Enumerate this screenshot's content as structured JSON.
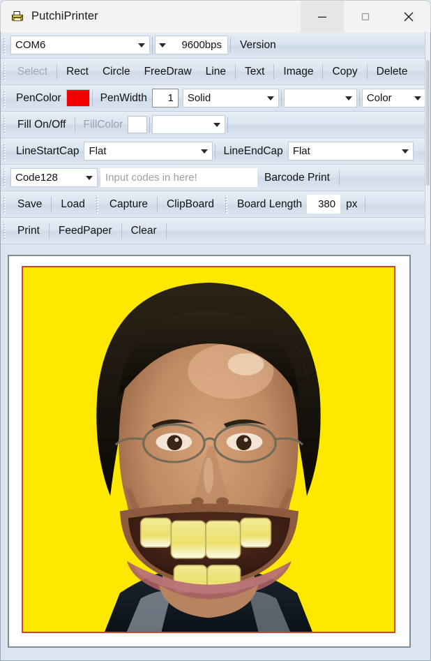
{
  "window": {
    "title": "PutchiPrinter",
    "icon": "printer-icon",
    "controls": {
      "minimize": "—",
      "maximize": "☐",
      "close": "✕"
    }
  },
  "toolbar_rows": {
    "connection": {
      "port_value": "COM6",
      "baud_value": "9600bps",
      "version_label": "Version"
    },
    "tools": {
      "select": "Select",
      "rect": "Rect",
      "circle": "Circle",
      "freedraw": "FreeDraw",
      "line": "Line",
      "text": "Text",
      "image": "Image",
      "copy": "Copy",
      "delete": "Delete"
    },
    "pen": {
      "pencolor_label": "PenColor",
      "pencolor_value": "#f40000",
      "penwidth_label": "PenWidth",
      "penwidth_value": "1",
      "dashstyle_value": "Solid",
      "unnamed_combo_value": "",
      "colormode_value": "Color"
    },
    "fill": {
      "fill_toggle_label": "Fill On/Off",
      "fillcolor_label": "FillColor",
      "fillcolor_value": "",
      "fill_combo_value": ""
    },
    "linecaps": {
      "startcap_label": "LineStartCap",
      "startcap_value": "Flat",
      "endcap_label": "LineEndCap",
      "endcap_value": "Flat"
    },
    "barcode": {
      "symbology_value": "Code128",
      "codes_value": "",
      "codes_placeholder": "Input codes in here!",
      "print_label": "Barcode Print"
    },
    "file": {
      "save": "Save",
      "load": "Load",
      "capture": "Capture",
      "clipboard": "ClipBoard",
      "board_length_label": "Board Length",
      "board_length_value": "380",
      "board_length_unit": "px"
    },
    "print": {
      "print": "Print",
      "feedpaper": "FeedPaper",
      "clear": "Clear"
    }
  },
  "canvas": {
    "image_border_color": "#d4432b",
    "image_background_color": "#ffe800",
    "image_description": "caricature-photo"
  }
}
